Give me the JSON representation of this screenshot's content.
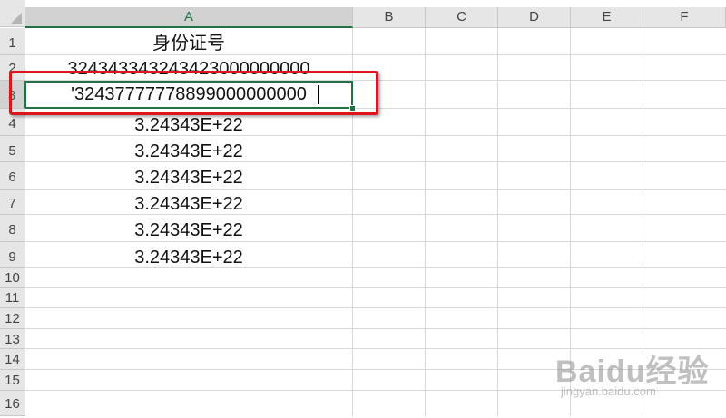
{
  "columns": [
    "A",
    "B",
    "C",
    "D",
    "E",
    "F"
  ],
  "selected_column": "A",
  "rows": [
    "1",
    "2",
    "3",
    "4",
    "5",
    "6",
    "7",
    "8",
    "9",
    "10",
    "11",
    "12",
    "13",
    "14",
    "15",
    "16"
  ],
  "selected_row": "3",
  "cells": {
    "A1": "身份证号",
    "A2": "324343343243423000000000",
    "A3_editing": "'32437777778899000000000",
    "A4": "3.24343E+22",
    "A5": "3.24343E+22",
    "A6": "3.24343E+22",
    "A7": "3.24343E+22",
    "A8": "3.24343E+22",
    "A9": "3.24343E+22"
  },
  "accent_color": "#217346",
  "highlight_color": "#e0141e",
  "watermark": {
    "brand": "Baidu经验",
    "url": "jingyan.baidu.com"
  }
}
